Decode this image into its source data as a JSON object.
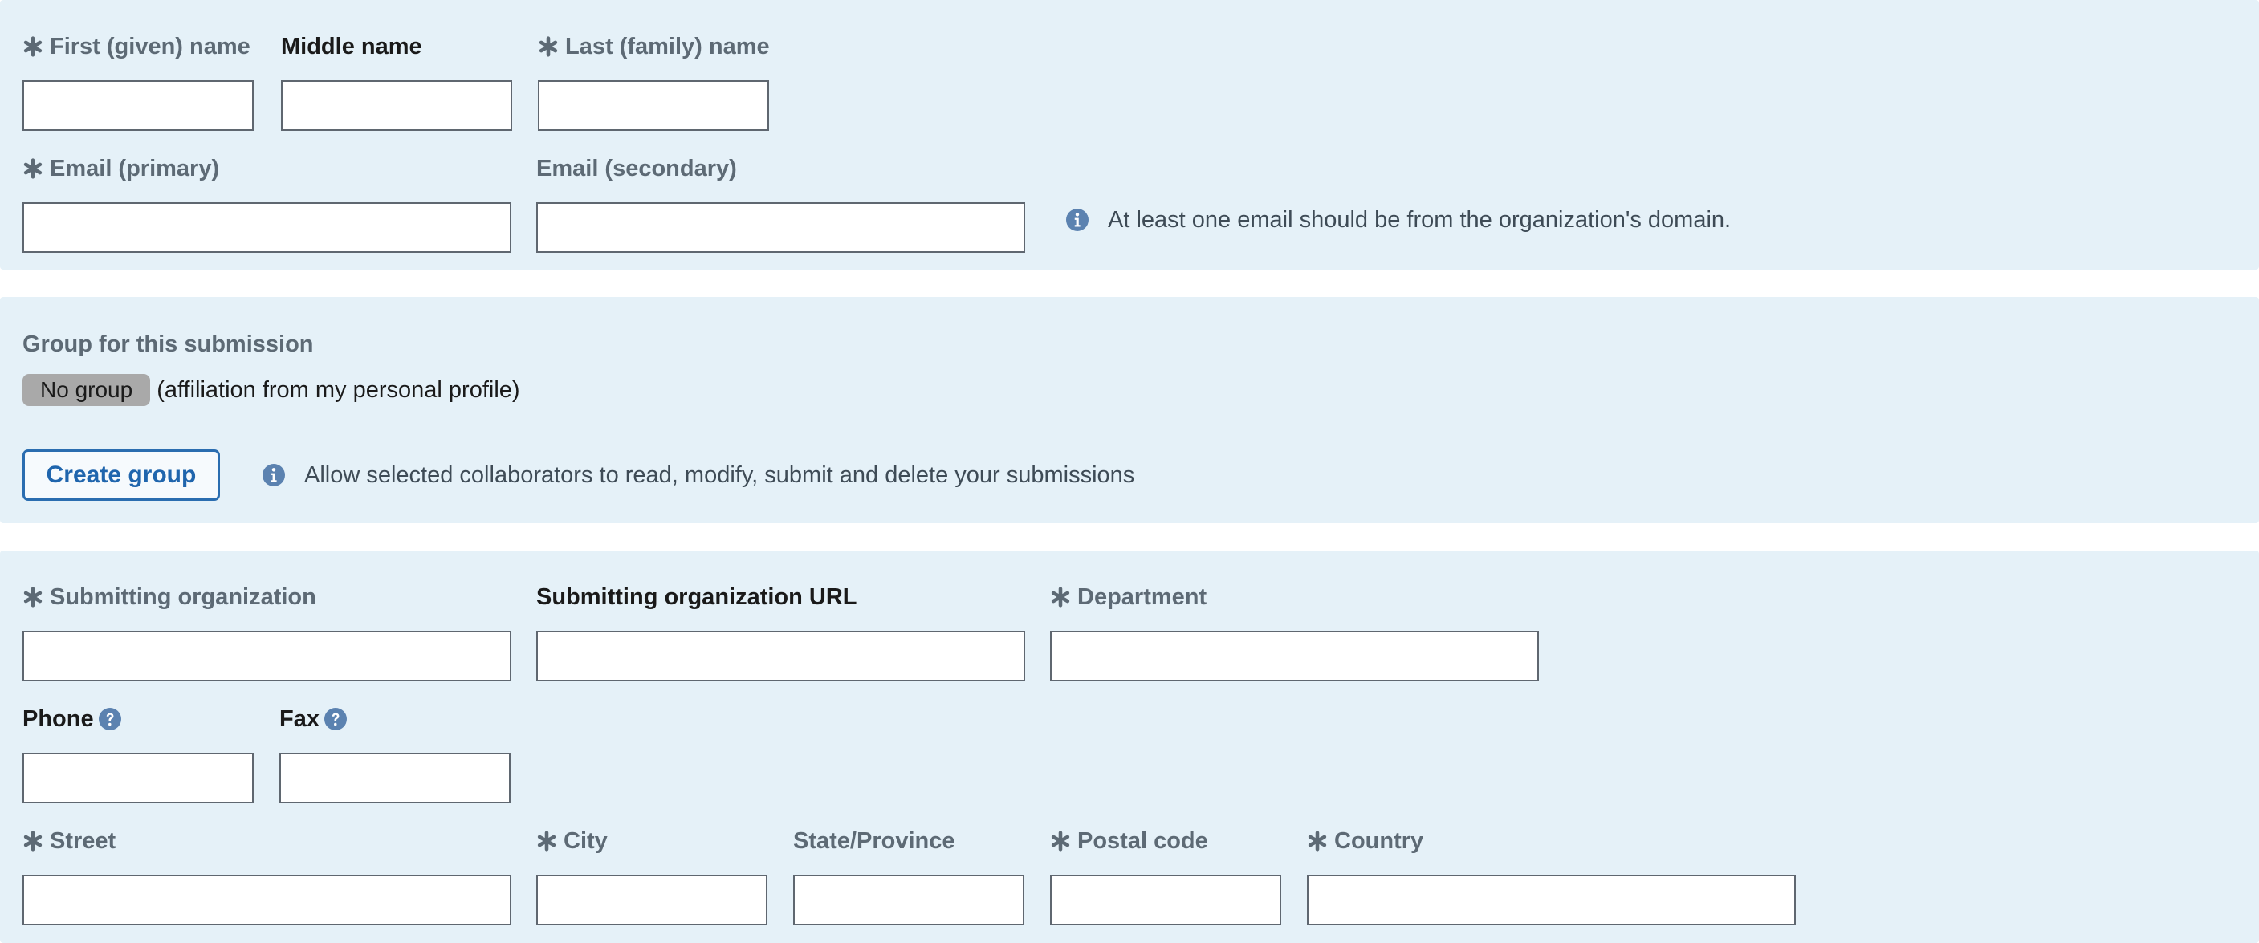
{
  "contact": {
    "first_name_label": "First (given) name",
    "middle_name_label": "Middle name",
    "last_name_label": "Last (family) name",
    "email_primary_label": "Email (primary)",
    "email_secondary_label": "Email (secondary)",
    "email_info": "At least one email should be from the organization's domain.",
    "first_name_value": "",
    "middle_name_value": "",
    "last_name_value": "",
    "email_primary_value": "",
    "email_secondary_value": ""
  },
  "group": {
    "heading": "Group for this submission",
    "badge": "No group",
    "affiliation_note": "(affiliation from my personal profile)",
    "create_button": "Create group",
    "collab_info": "Allow selected collaborators to read, modify, submit and delete your submissions"
  },
  "organization": {
    "org_label": "Submitting organization",
    "org_url_label": "Submitting organization URL",
    "department_label": "Department",
    "phone_label": "Phone",
    "fax_label": "Fax",
    "street_label": "Street",
    "city_label": "City",
    "state_label": "State/Province",
    "postal_label": "Postal code",
    "country_label": "Country"
  },
  "icons": {
    "required": "asterisk-icon",
    "info": "info-circle-icon",
    "help": "question-circle-icon"
  },
  "colors": {
    "panel_background": "#e5f1f8",
    "label_grey": "#5d6a75",
    "accent_blue": "#2a6db0",
    "icon_blue": "#5b82b0",
    "badge_grey": "#a9a9a9"
  }
}
